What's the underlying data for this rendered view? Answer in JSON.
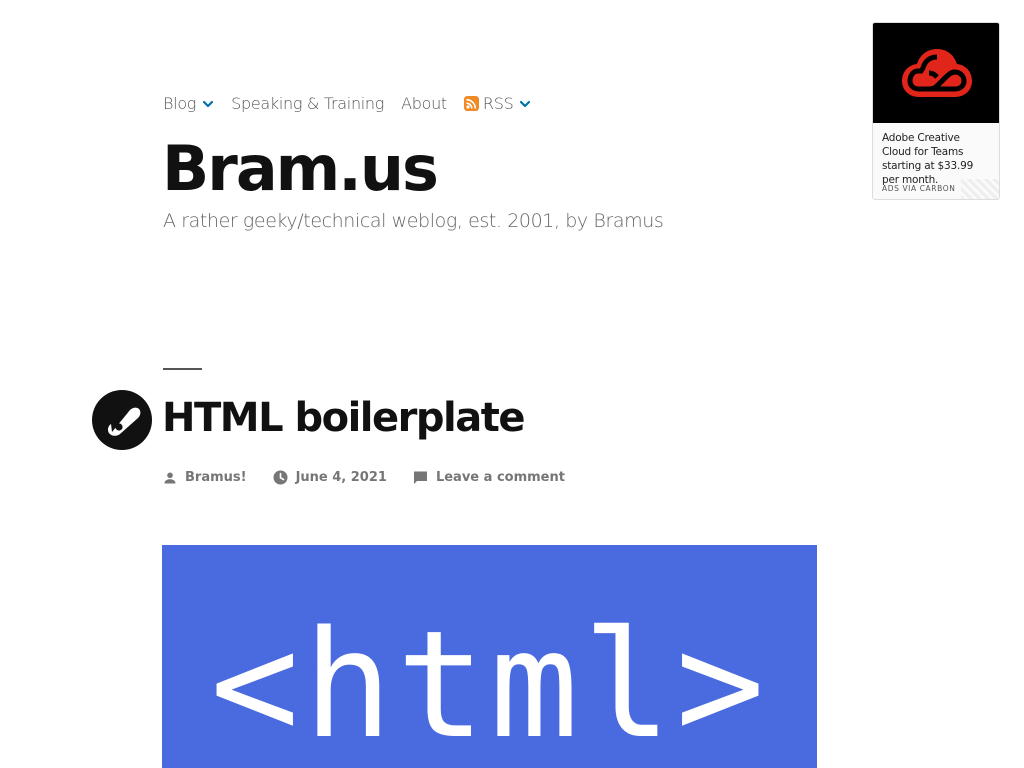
{
  "nav": {
    "items": [
      {
        "label": "Blog",
        "has_dropdown": true
      },
      {
        "label": "Speaking & Training",
        "has_dropdown": false
      },
      {
        "label": "About",
        "has_dropdown": false
      },
      {
        "label": "RSS",
        "has_dropdown": true,
        "icon": "rss-icon"
      }
    ]
  },
  "site": {
    "title": "Bram.us",
    "tagline": "A rather geeky/technical weblog, est. 2001, by Bramus"
  },
  "ad": {
    "image_icon": "adobe-creative-cloud-logo",
    "text": "Adobe Creative Cloud for Teams starting at $33.99 per month.",
    "powered_by": "ADS VIA CARBON"
  },
  "post": {
    "icon": "link-format-icon",
    "title": "HTML boilerplate",
    "author": "Bramus!",
    "date": "June 4, 2021",
    "comments": "Leave a comment",
    "featured_image_text": "<html>"
  },
  "colors": {
    "accent": "#0073aa",
    "rss": "#f08a24",
    "featured_bg": "#4a6be0",
    "adobe_red": "#e1251b"
  }
}
